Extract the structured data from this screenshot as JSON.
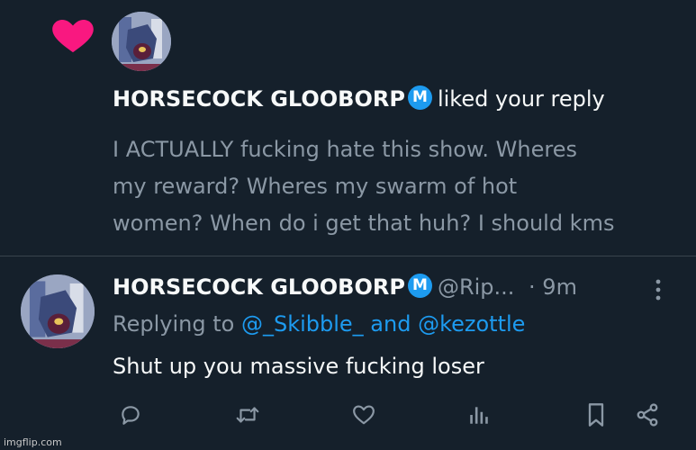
{
  "notification": {
    "icon": "heart-icon",
    "heart_color": "#f91880",
    "user_name": "HORSECOCK GLOOBORP",
    "badge_letter": "M",
    "action_text": "liked your reply",
    "quoted_text_lines": [
      "I ACTUALLY fucking hate this show. Wheres",
      "my reward? Wheres my swarm of hot",
      "women? When do i get that huh? I should kms"
    ]
  },
  "reply": {
    "user_name": "HORSECOCK GLOOBORP",
    "badge_letter": "M",
    "handle": "@Rip...",
    "time": "· 9m",
    "replying_prefix": "Replying to",
    "mention_1": "@_Skibble_",
    "mention_joiner": "and",
    "mention_2": "@kezottle",
    "body": "Shut up you massive fucking loser",
    "actions": [
      "reply-icon",
      "retweet-icon",
      "like-icon",
      "views-icon",
      "bookmark-icon",
      "share-icon"
    ]
  },
  "watermark": "imgflip.com",
  "colors": {
    "background": "#15202b",
    "text": "#f7f9f9",
    "muted": "#8b98a5",
    "link": "#1d9bf0",
    "divider": "#38444d"
  }
}
